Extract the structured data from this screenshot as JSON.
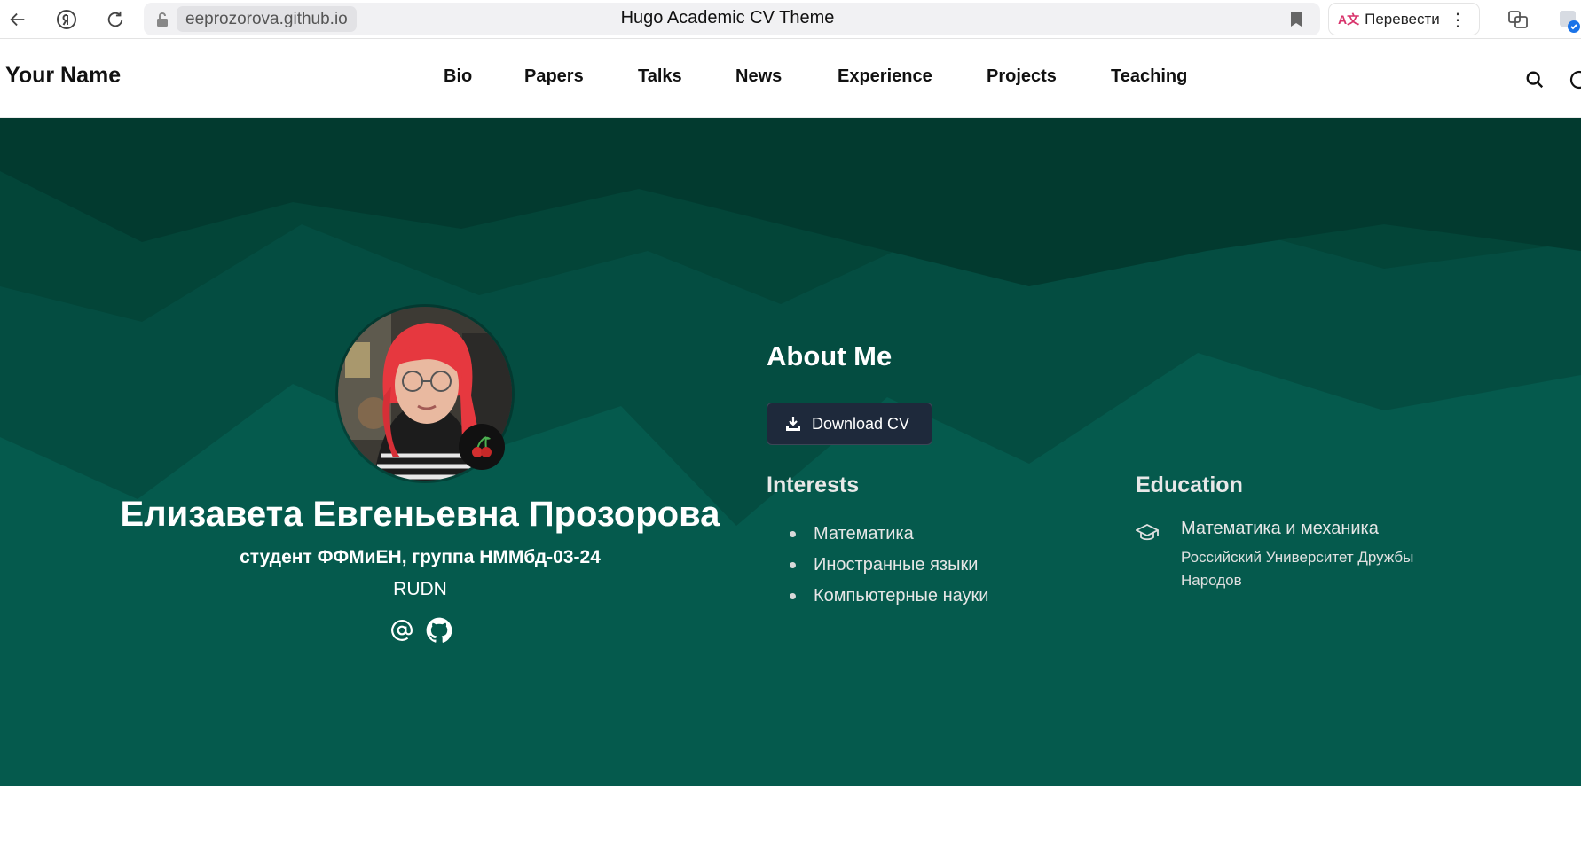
{
  "browser": {
    "domain": "eeprozorova.github.io",
    "tab_title": "Hugo Academic CV Theme",
    "translate_label": "Перевести"
  },
  "nav": {
    "brand": "Your Name",
    "links": [
      "Bio",
      "Papers",
      "Talks",
      "News",
      "Experience",
      "Projects",
      "Teaching"
    ]
  },
  "profile": {
    "name": "Елизавета Евгеньевна Прозорова",
    "role": "студент ФФМиЕН, группа НММбд-03-24",
    "organization": "RUDN",
    "social_icons": [
      "at-icon",
      "github-icon"
    ],
    "avatar_badge_icon": "cherry-icon"
  },
  "about": {
    "title": "About Me",
    "download_label": "Download CV"
  },
  "interests": {
    "title": "Interests",
    "items": [
      "Математика",
      "Иностранные языки",
      "Компьютерные науки"
    ]
  },
  "education": {
    "title": "Education",
    "items": [
      {
        "course": "Математика и механика",
        "institution": "Российский Университет Дружбы Народов"
      }
    ]
  },
  "colors": {
    "hero_dark": "#023a2f",
    "hero_mid": "#044a3e",
    "hero_light": "#055a4d",
    "button_bg": "#1e293b"
  }
}
